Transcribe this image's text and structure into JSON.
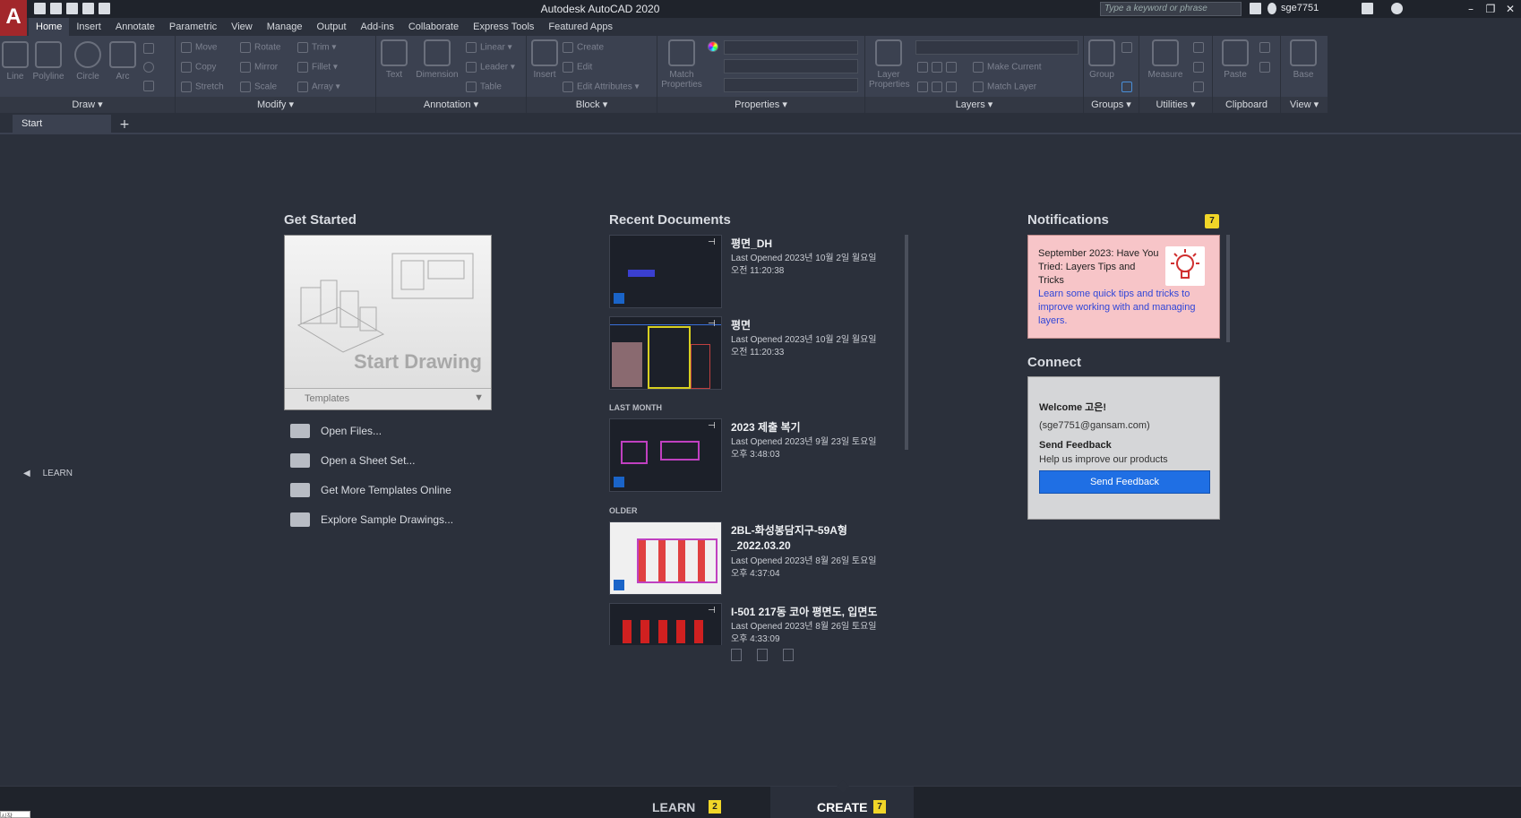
{
  "app": {
    "logo_label": "A",
    "title": "Autodesk AutoCAD 2020",
    "search_placeholder": "Type a keyword or phrase",
    "user": "sge7751"
  },
  "ribbon_tabs": [
    "Home",
    "Insert",
    "Annotate",
    "Parametric",
    "View",
    "Manage",
    "Output",
    "Add-ins",
    "Collaborate",
    "Express Tools",
    "Featured Apps"
  ],
  "ribbon": {
    "draw": {
      "title": "Draw",
      "tools": [
        "Line",
        "Polyline",
        "Circle",
        "Arc"
      ]
    },
    "modify": {
      "title": "Modify",
      "tools": [
        "Move",
        "Rotate",
        "Trim",
        "Copy",
        "Mirror",
        "Fillet",
        "Stretch",
        "Scale",
        "Array"
      ]
    },
    "annotation": {
      "title": "Annotation",
      "big": [
        "Text",
        "Dimension"
      ],
      "tools": [
        "Linear",
        "Leader",
        "Table"
      ]
    },
    "block": {
      "title": "Block",
      "big": [
        "Insert"
      ],
      "tools": [
        "Create",
        "Edit",
        "Edit Attributes"
      ]
    },
    "properties": {
      "title": "Properties",
      "big": [
        "Match Properties"
      ]
    },
    "layers": {
      "title": "Layers",
      "big": [
        "Layer Properties"
      ],
      "tools": [
        "Make Current",
        "Match Layer"
      ]
    },
    "groups": {
      "title": "Groups",
      "big": [
        "Group"
      ]
    },
    "utilities": {
      "title": "Utilities",
      "big": [
        "Measure"
      ]
    },
    "clipboard": {
      "title": "Clipboard",
      "big": [
        "Paste"
      ]
    },
    "view": {
      "title": "View",
      "big": [
        "Base"
      ]
    }
  },
  "doc_tabs": {
    "start": "Start",
    "add": "+"
  },
  "learn_side": "LEARN",
  "get_started": {
    "title": "Get Started",
    "card_label": "Start Drawing",
    "templates_label": "Templates",
    "links": [
      "Open Files...",
      "Open a Sheet Set...",
      "Get More Templates Online",
      "Explore Sample Drawings..."
    ]
  },
  "recent": {
    "title": "Recent Documents",
    "groups": {
      "last_month": "LAST MONTH",
      "older": "OLDER"
    },
    "docs": [
      {
        "name": "평면_DH",
        "meta1": "Last Opened 2023년 10월 2일 월요일",
        "meta2": "오전 11:20:38"
      },
      {
        "name": "평면",
        "meta1": "Last Opened 2023년 10월 2일 월요일",
        "meta2": "오전 11:20:33"
      },
      {
        "name": "2023 제출 복기",
        "meta1": "Last Opened 2023년 9월 23일 토요일",
        "meta2": "오후 3:48:03"
      },
      {
        "name": "2BL-화성봉담지구-59A형 _2022.03.20",
        "meta1": "Last Opened 2023년 8월 26일 토요일",
        "meta2": "오후 4:37:04"
      },
      {
        "name": "I-501 217동 코아 평면도, 입면도",
        "meta1": "Last Opened 2023년 8월 26일 토요일",
        "meta2": "오후 4:33:09"
      }
    ]
  },
  "notifications": {
    "title": "Notifications",
    "count": "7",
    "item_title": "September 2023: Have You Tried: Layers Tips and Tricks",
    "item_link": "Learn some quick tips and tricks to improve working with and managing layers."
  },
  "connect": {
    "title": "Connect",
    "welcome": "Welcome 고은!",
    "email": "(sge7751@gansam.com)",
    "feedback_title": "Send Feedback",
    "feedback_text": "Help us improve our products",
    "feedback_button": "Send Feedback"
  },
  "bottom": {
    "learn": "LEARN",
    "learn_count": "2",
    "create": "CREATE",
    "create_count": "7",
    "corner": "시작"
  },
  "colors": {
    "accent_red": "#a2272b",
    "badge_yellow": "#f1d628",
    "feedback_blue": "#1f6fe4",
    "notif_pink": "#f7c5c8"
  }
}
